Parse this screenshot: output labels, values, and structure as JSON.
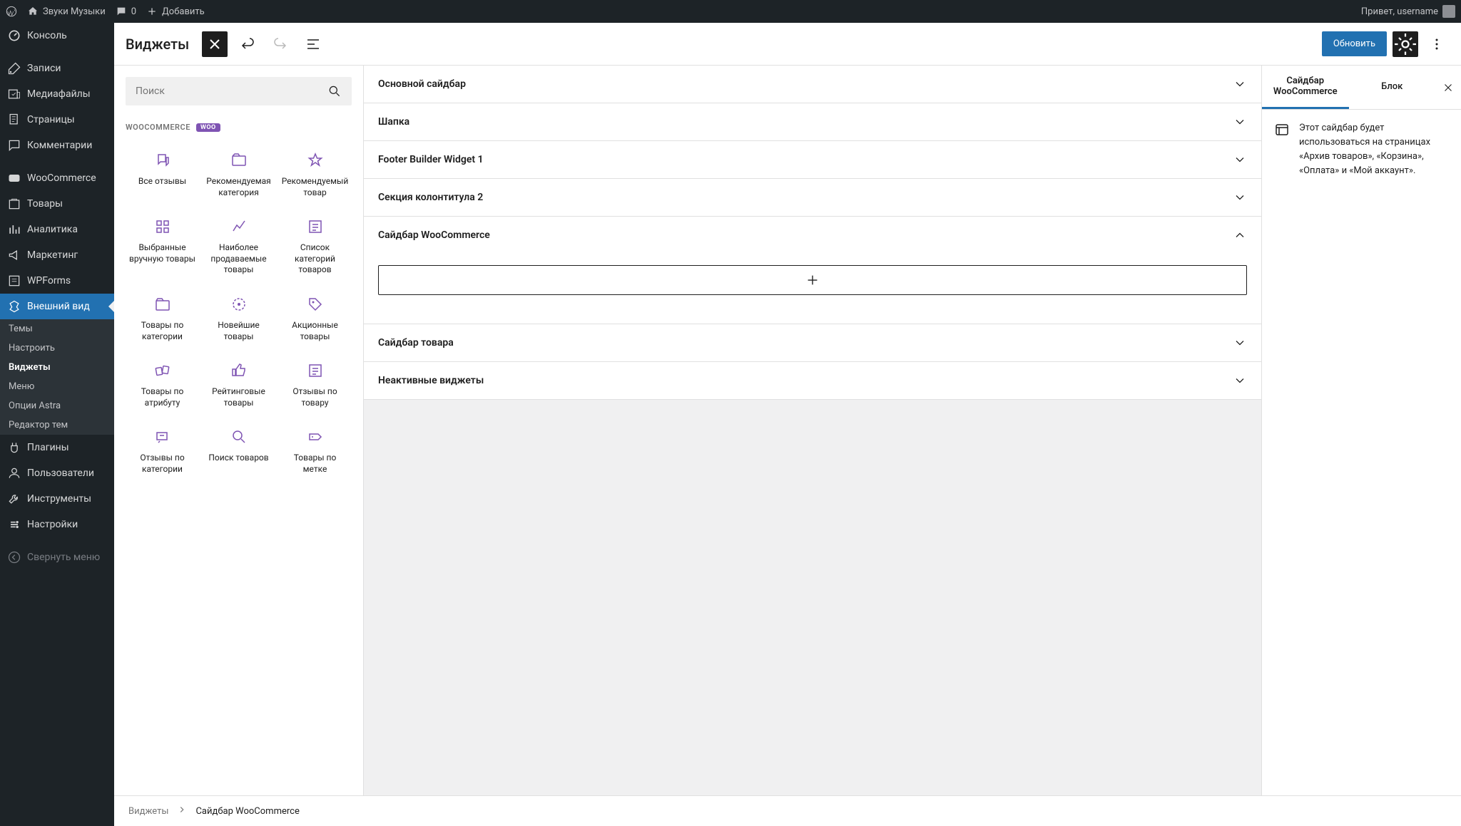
{
  "adminBar": {
    "siteName": "Звуки Музыки",
    "comments": "0",
    "add": "Добавить",
    "greeting": "Привет, username"
  },
  "sidebar": {
    "items": [
      {
        "label": "Консоль",
        "icon": "dashboard"
      },
      {
        "label": "Записи",
        "icon": "pin"
      },
      {
        "label": "Медиафайлы",
        "icon": "media"
      },
      {
        "label": "Страницы",
        "icon": "pages"
      },
      {
        "label": "Комментарии",
        "icon": "comments"
      },
      {
        "label": "WooCommerce",
        "icon": "woo"
      },
      {
        "label": "Товары",
        "icon": "products"
      },
      {
        "label": "Аналитика",
        "icon": "analytics"
      },
      {
        "label": "Маркетинг",
        "icon": "marketing"
      },
      {
        "label": "WPForms",
        "icon": "wpforms"
      },
      {
        "label": "Внешний вид",
        "icon": "appearance",
        "active": true
      },
      {
        "label": "Плагины",
        "icon": "plugins"
      },
      {
        "label": "Пользователи",
        "icon": "users"
      },
      {
        "label": "Инструменты",
        "icon": "tools"
      },
      {
        "label": "Настройки",
        "icon": "settings"
      }
    ],
    "collapse": "Свернуть меню",
    "subItems": [
      {
        "label": "Темы"
      },
      {
        "label": "Настроить"
      },
      {
        "label": "Виджеты",
        "active": true
      },
      {
        "label": "Меню"
      },
      {
        "label": "Опции Astra"
      },
      {
        "label": "Редактор тем"
      }
    ]
  },
  "topbar": {
    "title": "Виджеты",
    "updateLabel": "Обновить"
  },
  "inserter": {
    "searchPlaceholder": "Поиск",
    "sectionTitle": "WOOCOMMERCE",
    "badge": "WOO",
    "blocks": [
      {
        "label": "Все отзывы",
        "icon": "reviews"
      },
      {
        "label": "Рекомендуемая категория",
        "icon": "folder-star"
      },
      {
        "label": "Рекомендуемый товар",
        "icon": "star"
      },
      {
        "label": "Выбранные вручную товары",
        "icon": "grid"
      },
      {
        "label": "Наиболее продаваемые товары",
        "icon": "trend"
      },
      {
        "label": "Список категорий товаров",
        "icon": "list"
      },
      {
        "label": "Товары по категории",
        "icon": "folder"
      },
      {
        "label": "Новейшие товары",
        "icon": "new"
      },
      {
        "label": "Акционные товары",
        "icon": "tag"
      },
      {
        "label": "Товары по атрибуту",
        "icon": "cards"
      },
      {
        "label": "Рейтинговые товары",
        "icon": "thumbs"
      },
      {
        "label": "Отзывы по товару",
        "icon": "review-list"
      },
      {
        "label": "Отзывы по категории",
        "icon": "review-cat"
      },
      {
        "label": "Поиск товаров",
        "icon": "search"
      },
      {
        "label": "Товары по метке",
        "icon": "label"
      }
    ]
  },
  "widgetAreas": [
    {
      "label": "Основной сайдбар",
      "expanded": false
    },
    {
      "label": "Шапка",
      "expanded": false
    },
    {
      "label": "Footer Builder Widget 1",
      "expanded": false
    },
    {
      "label": "Секция колонтитула 2",
      "expanded": false
    },
    {
      "label": "Сайдбар WooCommerce",
      "expanded": true
    },
    {
      "label": "Сайдбар товара",
      "expanded": false
    },
    {
      "label": "Неактивные виджеты",
      "expanded": false
    }
  ],
  "rightSidebar": {
    "tab1": "Сайдбар WooCommerce",
    "tab2": "Блок",
    "description": "Этот сайдбар будет использоваться на страницах «Архив товаров», «Корзина», «Оплата» и «Мой аккаунт»."
  },
  "breadcrumb": {
    "root": "Виджеты",
    "current": "Сайдбар WooCommerce"
  }
}
